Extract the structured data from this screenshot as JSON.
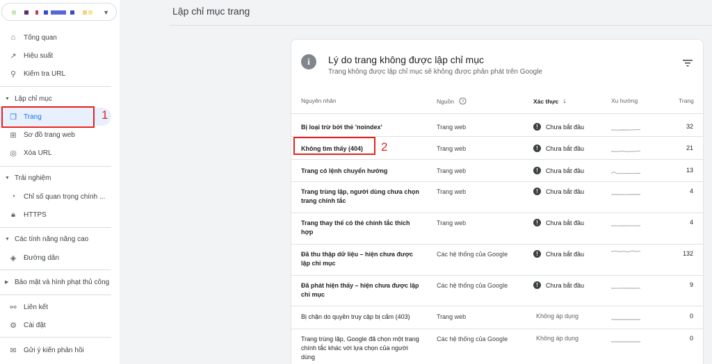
{
  "sidebar": {
    "items": [
      {
        "label": "Tổng quan",
        "icon": "home-icon",
        "glyph": "⌂"
      },
      {
        "label": "Hiệu suất",
        "icon": "trending-up-icon",
        "glyph": "↗"
      },
      {
        "label": "Kiểm tra URL",
        "icon": "search-icon",
        "glyph": "⚲"
      }
    ],
    "index_section": {
      "label": "Lập chỉ mục",
      "items": [
        {
          "label": "Trang",
          "icon": "pages-icon",
          "glyph": "❐"
        },
        {
          "label": "Sơ đồ trang web",
          "icon": "sitemap-icon",
          "glyph": "⊞"
        },
        {
          "label": "Xóa URL",
          "icon": "visibility-off-icon",
          "glyph": "◎"
        }
      ]
    },
    "experience_section": {
      "label": "Trải nghiệm",
      "items": [
        {
          "label": "Chỉ số quan trọng chính ...",
          "icon": "speed-icon",
          "glyph": "◔"
        },
        {
          "label": "HTTPS",
          "icon": "lock-icon",
          "glyph": "🔒︎"
        }
      ]
    },
    "advanced_section": {
      "label": "Các tính năng nâng cao",
      "items": [
        {
          "label": "Đường dẫn",
          "icon": "layers-icon",
          "glyph": "◈"
        }
      ]
    },
    "security_section": {
      "label": "Bảo mật và hình phạt thủ công"
    },
    "bottom_items": [
      {
        "label": "Liên kết",
        "icon": "links-icon",
        "glyph": "⚯"
      },
      {
        "label": "Cài đặt",
        "icon": "settings-icon",
        "glyph": "⚙"
      }
    ],
    "feedback": {
      "label": "Gửi ý kiến phản hồi",
      "icon": "feedback-icon",
      "glyph": "✉"
    }
  },
  "annotations": {
    "one": "1",
    "two": "2"
  },
  "header": {
    "title": "Lập chỉ mục trang"
  },
  "card": {
    "title": "Lý do trang không được lập chỉ mục",
    "subtitle": "Trang không được lập chỉ mục sẽ không được phân phát trên Google",
    "columns": {
      "reason": "Nguyên nhân",
      "source": "Nguồn",
      "validation": "Xác thực",
      "trend": "Xu hướng",
      "pages": "Trang"
    },
    "rows": [
      {
        "reason": "Bị loại trừ bởi thẻ 'noindex'",
        "source": "Trang web",
        "status": "Chưa bắt đầu",
        "pages": "32"
      },
      {
        "reason": "Không tìm thấy (404)",
        "source": "Trang web",
        "status": "Chưa bắt đầu",
        "pages": "21"
      },
      {
        "reason": "Trang có lệnh chuyển hướng",
        "source": "Trang web",
        "status": "Chưa bắt đầu",
        "pages": "13"
      },
      {
        "reason": "Trang trùng lặp, người dùng chưa chọn trang chính tắc",
        "source": "Trang web",
        "status": "Chưa bắt đầu",
        "pages": "4"
      },
      {
        "reason": "Trang thay thế có thẻ chính tắc thích hợp",
        "source": "Trang web",
        "status": "Chưa bắt đầu",
        "pages": "4"
      },
      {
        "reason": "Đã thu thập dữ liệu – hiện chưa được lập chỉ mục",
        "source": "Các hệ thống của Google",
        "status": "Chưa bắt đầu",
        "pages": "132"
      },
      {
        "reason": "Đã phát hiện thấy – hiện chưa được lập chỉ mục",
        "source": "Các hệ thống của Google",
        "status": "Chưa bắt đầu",
        "pages": "9"
      },
      {
        "reason": "Bị chặn do quyền truy cập bị cấm (403)",
        "source": "Trang web",
        "status": "Không áp dụng",
        "pages": "0"
      },
      {
        "reason": "Trang trùng lặp, Google đã chọn một trang chính tắc khác với lựa chọn của người dùng",
        "source": "Các hệ thống của Google",
        "status": "Không áp dụng",
        "pages": "0"
      }
    ]
  },
  "colors": {
    "accent": "#1a73e8",
    "annotation": "#e5211b",
    "active_bg": "#e8f0fe"
  }
}
